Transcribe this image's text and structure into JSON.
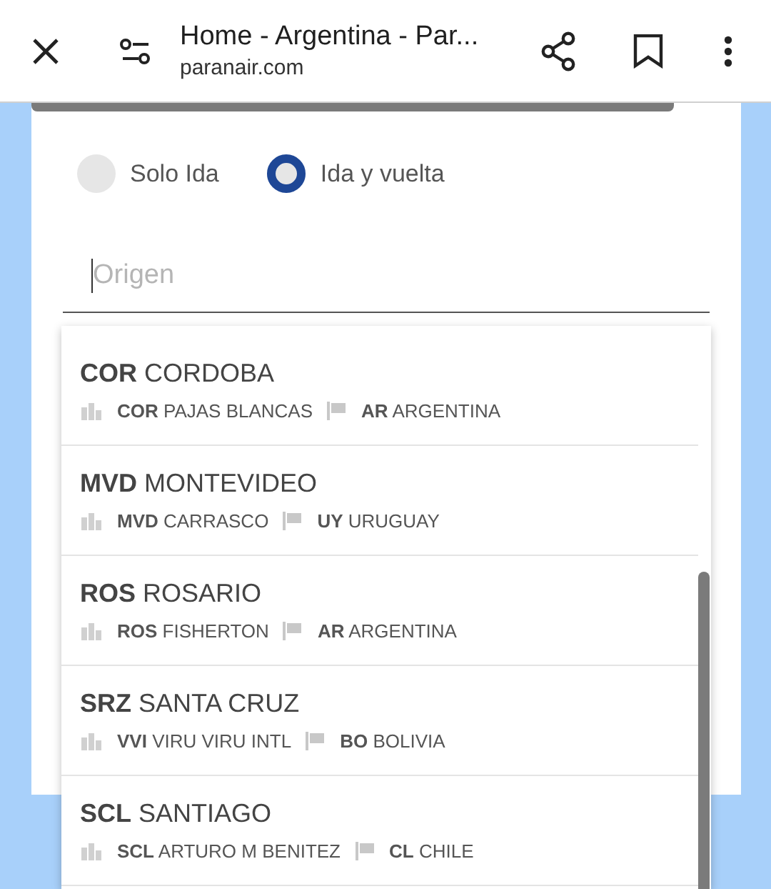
{
  "browser_bar": {
    "title": "Home - Argentina - Par...",
    "url": "paranair.com"
  },
  "trip_type": [
    {
      "label": "Solo Ida",
      "selected": false
    },
    {
      "label": "Ida y vuelta",
      "selected": true
    }
  ],
  "origin_field": {
    "placeholder": "Origen"
  },
  "suggestions": [
    {
      "city": "**COR** CORDOBA",
      "airport": "**COR** PAJAS BLANCAS",
      "country": "**AR** ARGENTINA"
    },
    {
      "city": "**MVD** MONTEVIDEO",
      "airport": "**MVD** CARRASCO",
      "country": "**UY** URUGUAY"
    },
    {
      "city": "**ROS** ROSARIO",
      "airport": "**ROS** FISHERTON",
      "country": "**AR** ARGENTINA"
    },
    {
      "city": "**SRZ** SANTA CRUZ",
      "airport": "**VVI** VIRU VIRU INTL",
      "country": "**BO** BOLIVIA"
    },
    {
      "city": "**SCL** SANTIAGO",
      "airport": "**SCL** ARTURO M BENITEZ",
      "country": "**CL** CHILE"
    }
  ]
}
